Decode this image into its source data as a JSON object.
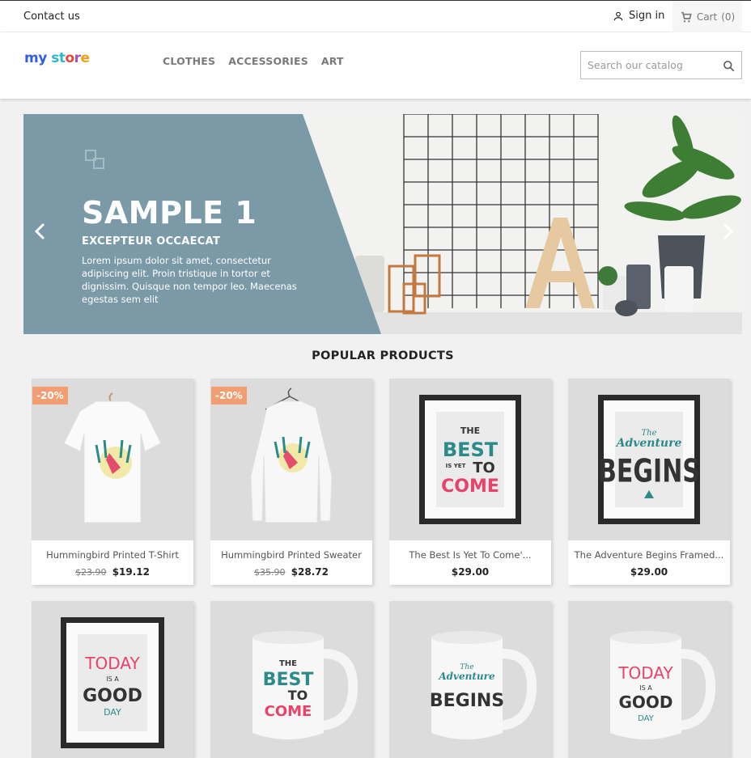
{
  "topbar": {
    "contact_label": "Contact us",
    "signin_label": "Sign in",
    "cart_label": "Cart",
    "cart_count": "(0)"
  },
  "header": {
    "logo": {
      "part1": "my",
      "part2": "st",
      "part3": "o",
      "part4": "r",
      "part5": "e"
    },
    "nav": [
      "CLOTHES",
      "ACCESSORIES",
      "ART"
    ],
    "search_placeholder": "Search our catalog"
  },
  "slider": {
    "title": "SAMPLE 1",
    "subtitle": "EXCEPTEUR OCCAECAT",
    "description": "Lorem ipsum dolor sit amet, consectetur adipiscing elit. Proin tristique in tortor et dignissim. Quisque non tempor leo. Maecenas egestas sem elit",
    "panel_color": "#7a9aa8"
  },
  "section_title": "POPULAR PRODUCTS",
  "products": [
    {
      "name": "Hummingbird Printed T-Shirt",
      "old_price": "$23.90",
      "price": "$19.12",
      "badge": "-20%"
    },
    {
      "name": "Hummingbird Printed Sweater",
      "old_price": "$35.90",
      "price": "$28.72",
      "badge": "-20%"
    },
    {
      "name": "The Best Is Yet To Come'...",
      "old_price": "",
      "price": "$29.00",
      "badge": ""
    },
    {
      "name": "The Adventure Begins Framed...",
      "old_price": "",
      "price": "$29.00",
      "badge": ""
    }
  ],
  "art": {
    "best": [
      "THE",
      "BEST",
      "IS YET",
      "TO",
      "COME"
    ],
    "adventure": [
      "The",
      "Adventure",
      "BEGINS"
    ],
    "today": [
      "TODAY",
      "IS A",
      "GOOD",
      "DAY"
    ]
  },
  "colors": {
    "accent": "#2fb5d2",
    "badge": "#f39d72",
    "teal": "#2b8a8a",
    "pink": "#e8436b"
  }
}
